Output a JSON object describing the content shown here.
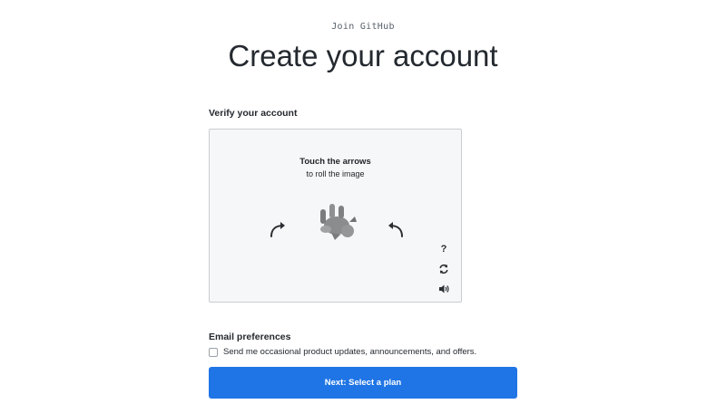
{
  "header": {
    "eyebrow": "Join GitHub",
    "title": "Create your account"
  },
  "verify": {
    "label": "Verify your account",
    "captcha": {
      "title": "Touch the arrows",
      "subtitle": "to roll the image",
      "help_glyph": "?",
      "icons": [
        "arrow-rotate-left-icon",
        "arrow-rotate-right-icon",
        "help-icon",
        "refresh-icon",
        "audio-icon"
      ]
    }
  },
  "email": {
    "label": "Email preferences",
    "checkbox_label": "Send me occasional product updates, announcements, and offers.",
    "checked": false
  },
  "actions": {
    "next_label": "Next: Select a plan"
  },
  "colors": {
    "primary_button": "#1f75e5",
    "captcha_background": "#f6f7f8"
  }
}
